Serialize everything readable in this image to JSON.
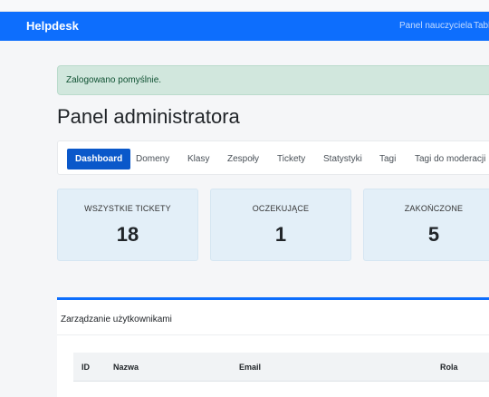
{
  "navbar": {
    "brand": "Helpdesk",
    "links": [
      "Panel nauczyciela",
      "Tabl"
    ]
  },
  "alert": {
    "text": "Zalogowano pomyślnie."
  },
  "page_title": "Panel administratora",
  "tabs": [
    {
      "label": "Dashboard",
      "active": true
    },
    {
      "label": "Domeny",
      "active": false
    },
    {
      "label": "Klasy",
      "active": false
    },
    {
      "label": "Zespoły",
      "active": false
    },
    {
      "label": "Tickety",
      "active": false
    },
    {
      "label": "Statystyki",
      "active": false
    },
    {
      "label": "Tagi",
      "active": false
    },
    {
      "label": "Tagi do moderacji",
      "active": false
    }
  ],
  "stats": [
    {
      "label": "WSZYSTKIE TICKETY",
      "value": "18"
    },
    {
      "label": "OCZEKUJĄCE",
      "value": "1"
    },
    {
      "label": "ZAKOŃCZONE",
      "value": "5"
    }
  ],
  "users_panel": {
    "title": "Zarządzanie użytkownikami",
    "columns": [
      "ID",
      "Nazwa",
      "Email",
      "Rola"
    ]
  },
  "colors": {
    "primary": "#0d6efd",
    "active_tab": "#0a58ca",
    "alert_bg": "#d1e7dd",
    "card_bg": "#e3eff8"
  }
}
